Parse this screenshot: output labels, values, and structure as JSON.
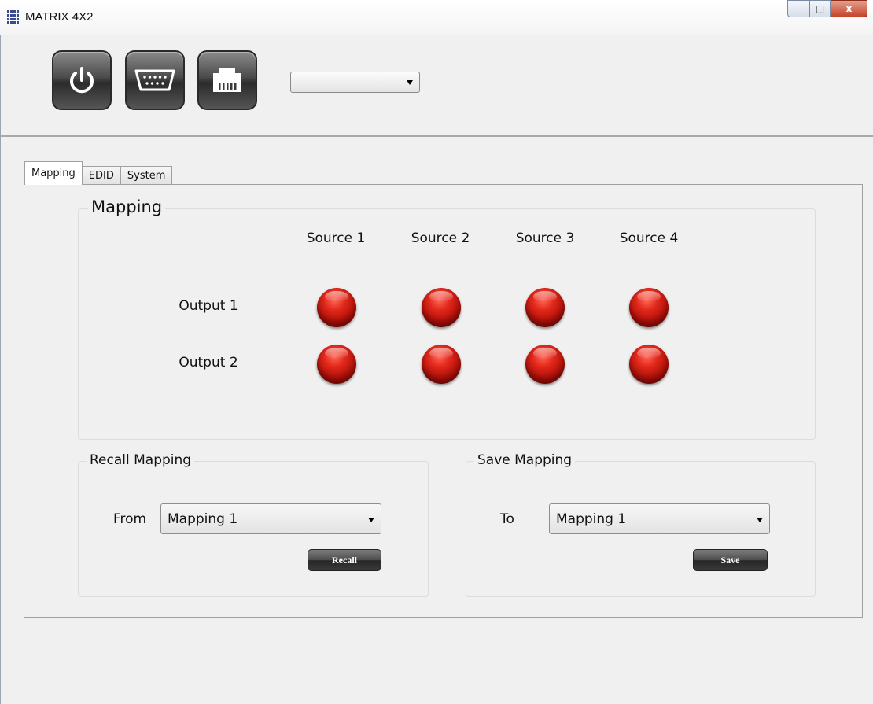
{
  "window": {
    "title": "MATRIX 4X2",
    "minimize_label": "—",
    "maximize_label": "□",
    "close_label": "x"
  },
  "toolbar": {
    "buttons": [
      {
        "icon": "power-icon"
      },
      {
        "icon": "serial-port-icon"
      },
      {
        "icon": "ethernet-port-icon"
      }
    ],
    "port_select_value": ""
  },
  "tabs": [
    {
      "label": "Mapping",
      "active": true
    },
    {
      "label": "EDID",
      "active": false
    },
    {
      "label": "System",
      "active": false
    }
  ],
  "mapping": {
    "title": "Mapping",
    "sources": [
      "Source 1",
      "Source 2",
      "Source 3",
      "Source 4"
    ],
    "outputs": [
      "Output 1",
      "Output 2"
    ],
    "led_color": "#c8160d"
  },
  "recall": {
    "title": "Recall Mapping",
    "from_label": "From",
    "selected": "Mapping 1",
    "button_label": "Recall"
  },
  "save": {
    "title": "Save Mapping",
    "to_label": "To",
    "selected": "Mapping 1",
    "button_label": "Save"
  }
}
